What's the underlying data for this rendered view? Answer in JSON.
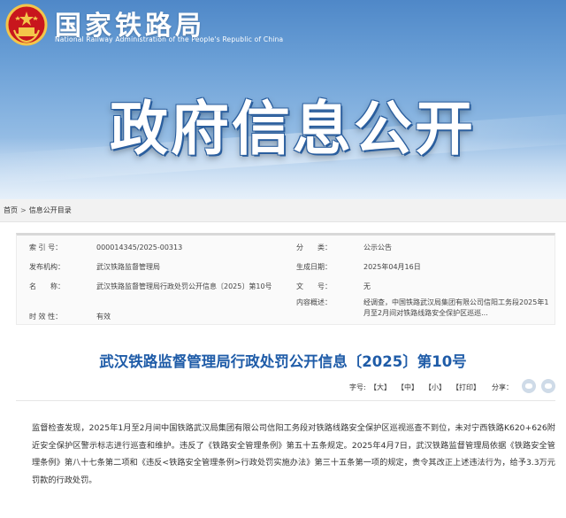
{
  "header": {
    "site_title": "国家铁路局",
    "site_subtitle": "National Railway Administration of the People's Republic of China",
    "banner_title": "政府信息公开",
    "emblem_icon": "national-emblem-icon"
  },
  "breadcrumb": {
    "items": [
      "首页",
      "信息公开目录"
    ],
    "separator": ">"
  },
  "info": {
    "index_label": "索 引 号：",
    "index_value": "000014345/2025-00313",
    "category_label": "分　　类：",
    "category_value": "公示公告",
    "issuer_label": "发布机构：",
    "issuer_value": "武汉铁路监督管理局",
    "date_label": "生成日期：",
    "date_value": "2025年04月16日",
    "name_label": "名　　称：",
    "name_value": "武汉铁路监督管理局行政处罚公开信息〔2025〕第10号",
    "docno_label": "文　　号：",
    "docno_value": "无",
    "summary_label": "内容概述：",
    "summary_value": "经调查，中国铁路武汉局集团有限公司信阳工务段2025年1月至2月间对铁路线路安全保护区巡巡...",
    "validity_label": "时 效 性：",
    "validity_value": "有效"
  },
  "article": {
    "title": "武汉铁路监督管理局行政处罚公开信息〔2025〕第10号",
    "font_size_label": "字号:",
    "size_large": "【大】",
    "size_medium": "【中】",
    "size_small": "【小】",
    "print": "【打印】",
    "share_label": "分享：",
    "body": "监督检查发现，2025年1月至2月间中国铁路武汉局集团有限公司信阳工务段对铁路线路安全保护区巡视巡查不到位，未对宁西铁路K620+626附近安全保护区警示标志进行巡查和维护。违反了《铁路安全管理条例》第五十五条规定。2025年4月7日，武汉铁路监督管理局依据《铁路安全管理条例》第八十七条第二项和《违反<铁路安全管理条例>行政处罚实施办法》第三十五条第一项的规定，责令其改正上述违法行为，给予3.3万元罚款的行政处罚。"
  },
  "colors": {
    "title_blue": "#1f5ca8",
    "banner_blue": "#4f88c8",
    "emblem_red": "#c8161d",
    "emblem_gold": "#f3c64a"
  }
}
